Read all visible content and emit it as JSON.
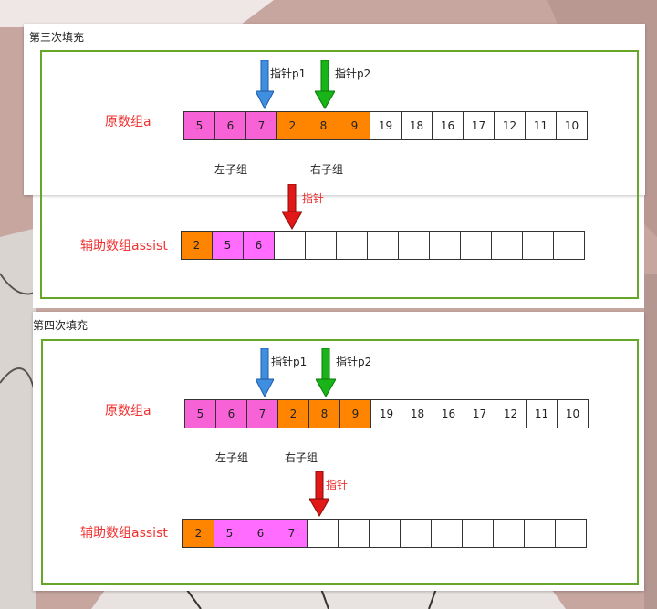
{
  "colors": {
    "frame": "#66a629",
    "blue_pointer": "#3f8ee0",
    "green_pointer": "#18b418",
    "red_pointer": "#e01818",
    "pink_cell": "#f862d7",
    "orange_cell": "#ff8500",
    "magenta_cell": "#ff6cff",
    "label_red": "#f03030"
  },
  "panel3": {
    "title": "第三次填充",
    "original_label": "原数组a",
    "original_cells": [
      "5",
      "6",
      "7",
      "2",
      "8",
      "9",
      "19",
      "18",
      "16",
      "17",
      "12",
      "11",
      "10"
    ],
    "p1_label": "指针p1",
    "p2_label": "指针p2",
    "left_group": "左子组",
    "right_group": "右子组",
    "pointer_label": "指针",
    "assist_label": "辅助数组assist",
    "assist_cells": [
      "2",
      "5",
      "6",
      "",
      "",
      "",
      "",
      "",
      "",
      "",
      "",
      "",
      ""
    ]
  },
  "panel4": {
    "title": "第四次填充",
    "original_label": "原数组a",
    "original_cells": [
      "5",
      "6",
      "7",
      "2",
      "8",
      "9",
      "19",
      "18",
      "16",
      "17",
      "12",
      "11",
      "10"
    ],
    "p1_label": "指针p1",
    "p2_label": "指针p2",
    "left_group": "左子组",
    "right_group": "右子组",
    "pointer_label": "指针",
    "assist_label": "辅助数组assist",
    "assist_cells": [
      "2",
      "5",
      "6",
      "7",
      "",
      "",
      "",
      "",
      "",
      "",
      "",
      "",
      ""
    ]
  }
}
